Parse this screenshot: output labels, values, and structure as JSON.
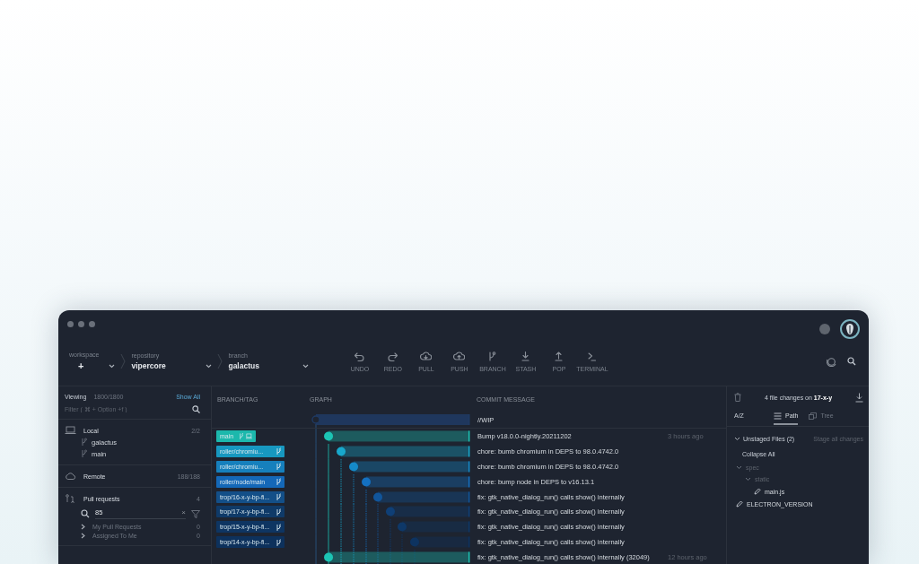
{
  "toolbar": {
    "crumbs": [
      {
        "label": "workspace",
        "value": "+"
      },
      {
        "label": "repository",
        "value": "vipercore"
      },
      {
        "label": "branch",
        "value": "galactus"
      }
    ],
    "actions": [
      {
        "kind": "undo",
        "label": "UNDO"
      },
      {
        "kind": "redo",
        "label": "REDO"
      },
      {
        "kind": "pull",
        "label": "PULL"
      },
      {
        "kind": "push",
        "label": "PUSH"
      },
      {
        "kind": "branch",
        "label": "BRANCH"
      },
      {
        "kind": "stash",
        "label": "STASH"
      },
      {
        "kind": "pop",
        "label": "POP"
      },
      {
        "kind": "terminal",
        "label": "TERMINAL"
      }
    ]
  },
  "sidebar": {
    "viewing_label": "Viewing",
    "viewing_count": "1800/1800",
    "show_all": "Show All",
    "filter": {
      "placeholder": "Filter ( ⌘ + Option +f )"
    },
    "sections": [
      {
        "kind": "local",
        "title": "Local",
        "count": "2/2",
        "items": [
          "galactus",
          "main"
        ]
      },
      {
        "kind": "remote",
        "title": "Remote",
        "count": "188/188"
      },
      {
        "kind": "pulls",
        "title": "Pull requests",
        "count": "4",
        "search": {
          "value": "85",
          "clear": "×"
        },
        "items": [
          {
            "label": "My Pull Requests",
            "count": "0"
          },
          {
            "label": "Assigned To Me",
            "count": "0"
          }
        ]
      }
    ]
  },
  "graph": {
    "columns": [
      "BRANCH/TAG",
      "GRAPH",
      "COMMIT MESSAGE"
    ],
    "rows": [
      {
        "kind": "wip",
        "message": "//WIP",
        "color": "#1f3a63"
      },
      {
        "kind": "commit",
        "message": "Bump v18.0.0-nightly.20211202",
        "time": "3 hours ago",
        "color": "#1cc4b4",
        "branch": {
          "label": "main",
          "color": "#1cb8ac",
          "local": true
        }
      },
      {
        "kind": "commit",
        "message": "chore: bumb chromium in DEPS to 98.0.4742.0",
        "color": "#18a8cc",
        "branch": {
          "label": "roller/chromiu...",
          "color": "#1798c0",
          "local": false
        }
      },
      {
        "kind": "commit",
        "message": "chore: bumb chromium in DEPS to 98.0.4742.0",
        "color": "#158ac8",
        "branch": {
          "label": "roller/chromiu...",
          "color": "#1680bd",
          "local": false
        }
      },
      {
        "kind": "commit",
        "message": "chore: bump node in DEPS to v16.13.1",
        "color": "#1470c0",
        "branch": {
          "label": "roller/node/main",
          "color": "#1468b8",
          "local": false
        }
      },
      {
        "kind": "commit",
        "message": "fix: gtk_native_dialog_run() calls show() internally",
        "color": "#11559a",
        "branch": {
          "label": "trop/16-x-y-bp-fi...",
          "color": "#134f88",
          "local": false
        }
      },
      {
        "kind": "commit",
        "message": "fix: gtk_native_dialog_run() calls show() internally",
        "color": "#0f3f76",
        "branch": {
          "label": "trop/17-x-y-bp-fi...",
          "color": "#0f3a68",
          "local": false
        }
      },
      {
        "kind": "commit",
        "message": "fix: gtk_native_dialog_run() calls show() internally",
        "color": "#0e3868",
        "branch": {
          "label": "trop/15-x-y-bp-fi...",
          "color": "#0e3562",
          "local": false
        }
      },
      {
        "kind": "commit",
        "message": "fix: gtk_native_dialog_run() calls show() internally",
        "color": "#0d3360",
        "branch": {
          "label": "trop/14-x-y-bp-fi...",
          "color": "#0d315c",
          "local": false
        }
      },
      {
        "kind": "commit",
        "message": "fix: gtk_native_dialog_run() calls show() internally (32049)",
        "time": "12 hours ago",
        "color": "#1cc4b4"
      }
    ]
  },
  "changes": {
    "summary": "4 file changes on **17-x-y**",
    "tabs": [
      {
        "label": "A/Z",
        "kind": "sort",
        "selected": false
      },
      {
        "label": "Path",
        "kind": "path",
        "selected": true
      },
      {
        "label": "Tree",
        "kind": "tree",
        "selected": false
      }
    ],
    "unstaged": {
      "title": "Unstaged Files (2)",
      "expanded": true,
      "action": "Stage all changes"
    },
    "collapse_all": "Collapse All",
    "tree": [
      {
        "name": "spec",
        "kind": "folder",
        "expanded": true,
        "children": [
          {
            "name": "static",
            "kind": "folder",
            "expanded": true,
            "children": [
              {
                "name": "main.js",
                "kind": "file"
              }
            ]
          }
        ]
      },
      {
        "name": "ELECTRON_VERSION",
        "kind": "file"
      }
    ]
  }
}
